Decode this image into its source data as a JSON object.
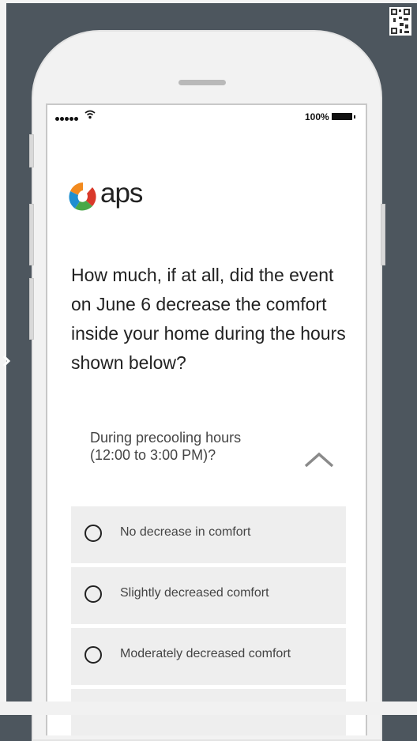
{
  "status_bar": {
    "battery": "100%"
  },
  "brand": {
    "name": "aps"
  },
  "question": "How much, if at all, did the event on June 6 decrease the comfort inside your home during the hours shown below?",
  "sub_question": {
    "line1": "During precooling hours",
    "line2": "(12:00 to 3:00 PM)?"
  },
  "options": [
    {
      "label": "No decrease in comfort"
    },
    {
      "label": "Slightly decreased comfort"
    },
    {
      "label": "Moderately decreased comfort"
    },
    {
      "label": ""
    }
  ],
  "colors": {
    "background": "#4d565e",
    "option_bg": "#eeeeee",
    "logo_orange": "#f28a1e",
    "logo_blue": "#1f8fd0",
    "logo_green": "#48a847",
    "logo_red": "#d9392a"
  },
  "icons": [
    "qr-code-icon",
    "wifi-icon",
    "battery-icon",
    "chevron-up-icon",
    "radio-icon"
  ]
}
